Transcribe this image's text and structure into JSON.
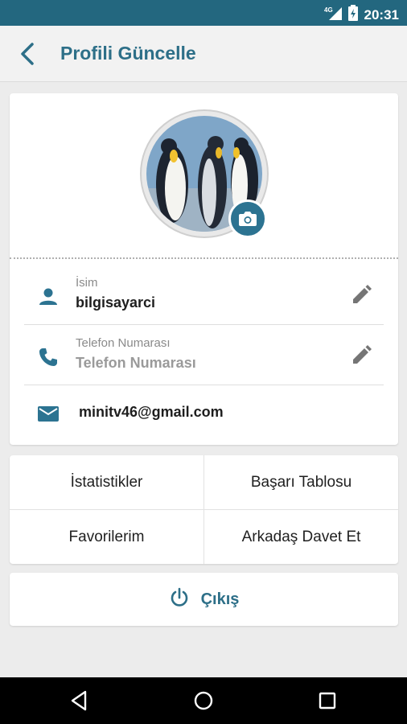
{
  "status_bar": {
    "time": "20:31",
    "network": "4G"
  },
  "header": {
    "title": "Profili Güncelle",
    "back_icon": "back-arrow-icon"
  },
  "profile": {
    "avatar_alt": "penguins",
    "name": {
      "label": "İsim",
      "value": "bilgisayarci"
    },
    "phone": {
      "label": "Telefon Numarası",
      "value": "Telefon Numarası"
    },
    "email": {
      "value": "minitv46@gmail.com"
    }
  },
  "menu": {
    "statistics": "İstatistikler",
    "leaderboard": "Başarı Tablosu",
    "favorites": "Favorilerim",
    "invite": "Arkadaş Davet Et"
  },
  "logout": {
    "label": "Çıkış"
  },
  "colors": {
    "primary": "#2d6f88",
    "statusbar": "#23677f",
    "background": "#ececec"
  }
}
